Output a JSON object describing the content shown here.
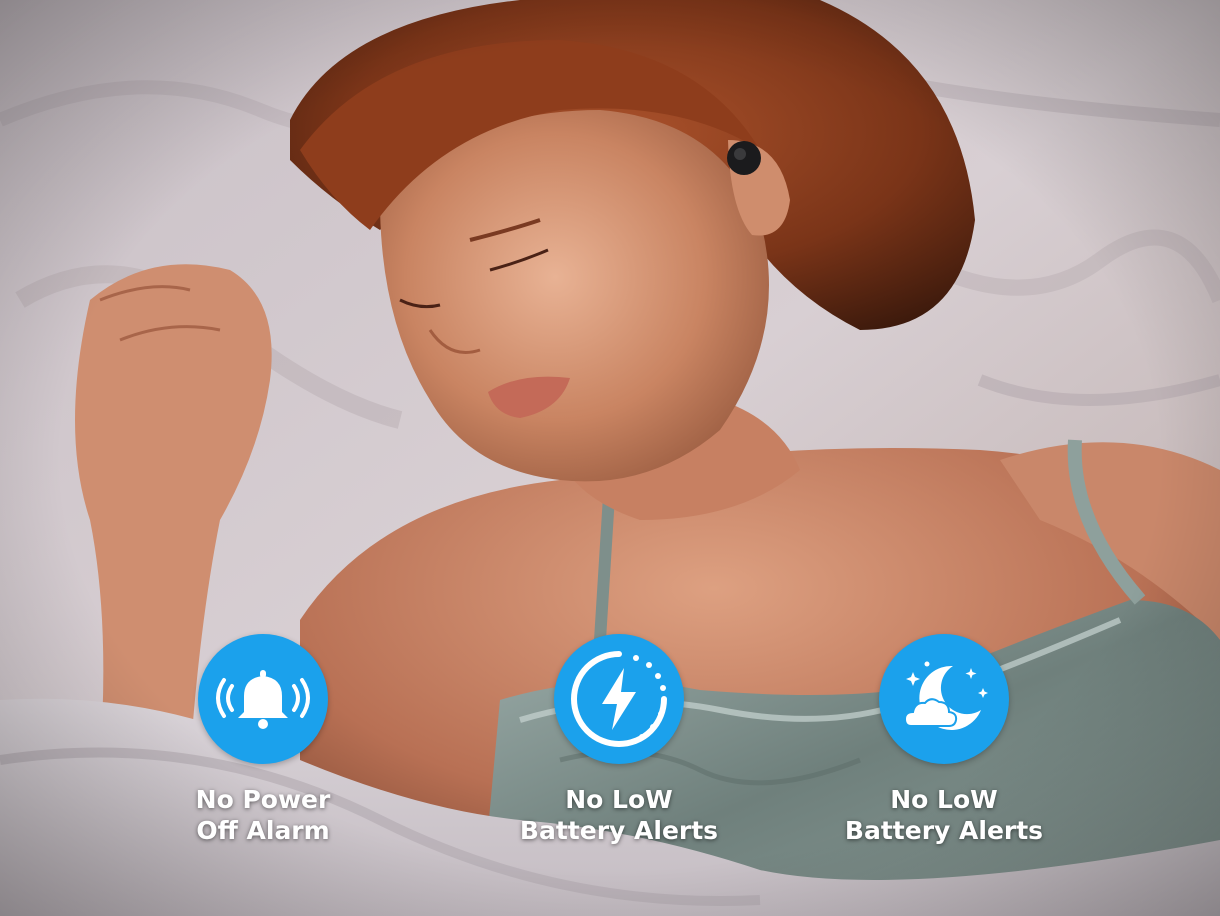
{
  "features": [
    {
      "line1": "No Power",
      "line2": "Off Alarm",
      "icon": "bell-icon"
    },
    {
      "line1": "No LoW",
      "line2": "Battery Alerts",
      "icon": "lightning-bolt-icon"
    },
    {
      "line1": "No LoW",
      "line2": "Battery Alerts",
      "icon": "moon-cloud-icon"
    }
  ],
  "colors": {
    "badge": "#1ba1ec",
    "caption": "#ffffff"
  }
}
